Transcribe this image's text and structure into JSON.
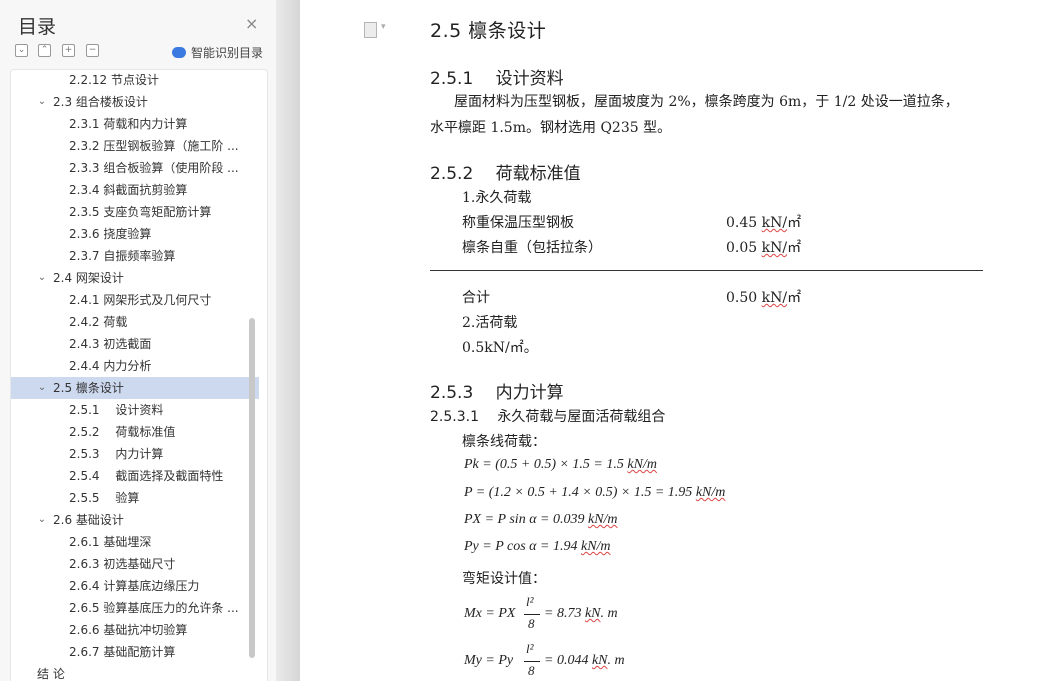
{
  "sidebar": {
    "title": "目录",
    "close_glyph": "×",
    "tools": [
      "⌄",
      "⌃",
      "+",
      "−"
    ],
    "smart_label": "智能识别目录",
    "items": [
      {
        "label": "2.2.12 节点设计",
        "level": 3
      },
      {
        "label": "2.3 组合楼板设计",
        "level": 2,
        "expanded": true
      },
      {
        "label": "2.3.1 荷载和内力计算",
        "level": 3
      },
      {
        "label": "2.3.2 压型钢板验算（施工阶 ...",
        "level": 3
      },
      {
        "label": "2.3.3 组合板验算（使用阶段 ...",
        "level": 3
      },
      {
        "label": "2.3.4 斜截面抗剪验算",
        "level": 3
      },
      {
        "label": "2.3.5 支座负弯矩配筋计算",
        "level": 3
      },
      {
        "label": "2.3.6 挠度验算",
        "level": 3
      },
      {
        "label": "2.3.7 自振频率验算",
        "level": 3
      },
      {
        "label": "2.4 网架设计",
        "level": 2,
        "expanded": true
      },
      {
        "label": "2.4.1 网架形式及几何尺寸",
        "level": 3
      },
      {
        "label": "2.4.2 荷载",
        "level": 3
      },
      {
        "label": "2.4.3 初选截面",
        "level": 3
      },
      {
        "label": "2.4.4 内力分析",
        "level": 3
      },
      {
        "label": "2.5 檩条设计",
        "level": 2,
        "expanded": true,
        "active": true
      },
      {
        "label": "2.5.1　 设计资料",
        "level": 3
      },
      {
        "label": "2.5.2　 荷载标准值",
        "level": 3
      },
      {
        "label": "2.5.3　 内力计算",
        "level": 3
      },
      {
        "label": "2.5.4　 截面选择及截面特性",
        "level": 3
      },
      {
        "label": "2.5.5　 验算",
        "level": 3
      },
      {
        "label": "2.6 基础设计",
        "level": 2,
        "expanded": true
      },
      {
        "label": "2.6.1 基础埋深",
        "level": 3
      },
      {
        "label": "2.6.3 初选基础尺寸",
        "level": 3
      },
      {
        "label": "2.6.4 计算基底边缘压力",
        "level": 3
      },
      {
        "label": "2.6.5 验算基底压力的允许条 ...",
        "level": 3
      },
      {
        "label": "2.6.6 基础抗冲切验算",
        "level": 3
      },
      {
        "label": "2.6.7 基础配筋计算",
        "level": 3
      },
      {
        "label": "结 论",
        "level": 1
      }
    ]
  },
  "doc": {
    "h_2_5": "2.5 檩条设计",
    "h_2_5_1": "2.5.1　 设计资料",
    "para1_line1": "屋面材料为压型钢板，屋面坡度为 2%，檩条跨度为 6m，于 1/2 处设一道拉条，",
    "para1_line2": "水平檩距 1.5m。钢材选用 Q235 型。",
    "h_2_5_2": "2.5.2　 荷载标准值",
    "perm_load": "1.永久荷载",
    "row1_label": "称重保温压型钢板",
    "row1_value": "0.45",
    "row2_label": "檩条自重（包括拉条）",
    "row2_value": "0.05",
    "total_label": "合计",
    "total_value": "0.50",
    "unit_kn": "kN/",
    "unit_sq": "㎡",
    "live_load": "2.活荷载",
    "live_value": "0.5kN/㎡。",
    "h_2_5_3": "2.5.3　 内力计算",
    "h_2_5_3_1": "2.5.3.1　 永久荷载与屋面活荷载组合",
    "line_load_label": "檩条线荷载：",
    "eq1": "Pk = (0.5 + 0.5) × 1.5 = 1.5",
    "eq2": "P = (1.2 × 0.5 + 1.4 × 0.5) × 1.5 = 1.95",
    "eq3": "PX = P sin α = 0.039",
    "eq4": "Py = P cos α = 1.94",
    "unit_knm": "kN/m",
    "moment_label": "弯矩设计值：",
    "eq5_left": "Mx = PX",
    "eq5_right": "= 8.73",
    "eq6_left": "My = Py",
    "eq6_right": "= 0.044",
    "frac_num": "l²",
    "frac_den": "8",
    "unit_kn_m_kn": "kN",
    "unit_kn_m_m": ". m"
  }
}
